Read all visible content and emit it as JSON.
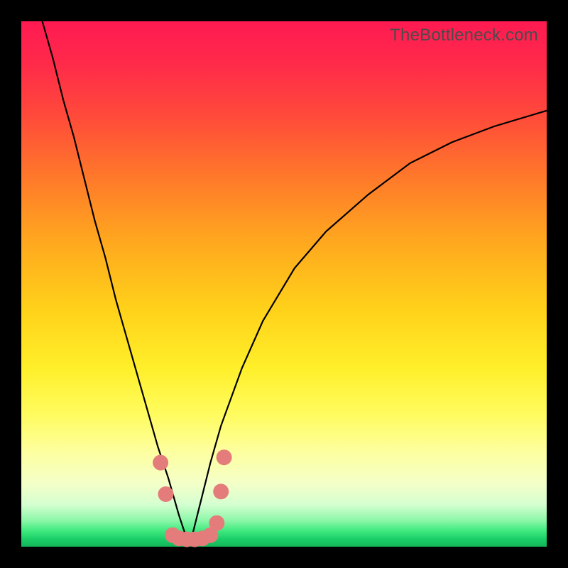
{
  "watermark": "TheBottleneck.com",
  "colors": {
    "top": "#ff1a52",
    "mid": "#ffe84a",
    "bottom": "#13b45a",
    "curve": "#000000",
    "marker": "#e57c7c",
    "frame": "#000000"
  },
  "chart_data": {
    "type": "line",
    "title": "",
    "subtitle": "",
    "xlabel": "",
    "ylabel": "",
    "xlim": [
      0,
      100
    ],
    "ylim": [
      0,
      100
    ],
    "grid": false,
    "legend": false,
    "annotations": [
      "TheBottleneck.com"
    ],
    "background": "vertical-gradient red→yellow→green",
    "note": "Axes are unlabeled; x and y values are estimated as percentages of the plot area (x left→right, y measured as height from the bottom baseline). The two curves form a V meeting near x≈32, y≈0.",
    "series": [
      {
        "name": "left-curve",
        "x": [
          4,
          6,
          8,
          10,
          12,
          14,
          16,
          18,
          20,
          22,
          24,
          26,
          28,
          30,
          32
        ],
        "y": [
          100,
          93,
          85,
          78,
          70,
          62,
          55,
          47,
          40,
          33,
          26,
          19,
          13,
          6,
          0
        ]
      },
      {
        "name": "right-curve",
        "x": [
          32,
          34,
          36,
          38,
          42,
          46,
          52,
          58,
          66,
          74,
          82,
          90,
          100
        ],
        "y": [
          0,
          8,
          16,
          23,
          34,
          43,
          53,
          60,
          67,
          73,
          77,
          80,
          83
        ]
      },
      {
        "name": "markers",
        "style": "scatter",
        "x": [
          26.5,
          27.5,
          28.8,
          30.0,
          31.5,
          33.0,
          34.5,
          36.0,
          37.2,
          38.0,
          38.6
        ],
        "y": [
          16.0,
          10.0,
          2.2,
          1.6,
          1.4,
          1.4,
          1.6,
          2.2,
          4.5,
          10.5,
          17.0
        ]
      }
    ]
  }
}
